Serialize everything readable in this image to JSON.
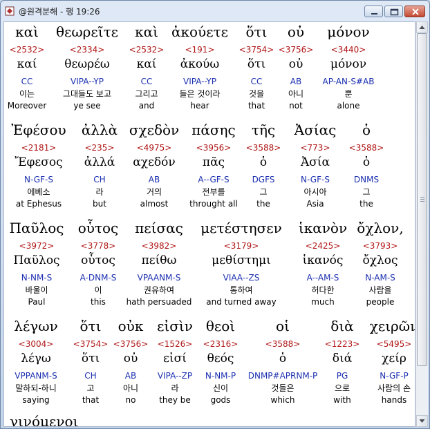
{
  "window": {
    "title": "@원격분해 - 행 19:26"
  },
  "colors": {
    "strong": "#b01515",
    "parse": "#1b2fb0",
    "titlebar": "#dfe9f6"
  },
  "rows": [
    {
      "words": [
        {
          "greek": "καὶ",
          "strong": "<2532>",
          "lemma": "καί",
          "parse": "CC",
          "korean": "이는",
          "english": "Moreover"
        },
        {
          "greek": "θεωρεῖτε",
          "strong": "<2334>",
          "lemma": "θεωρέω",
          "parse": "VIPA--YP",
          "korean": "그대들도 보고",
          "english": "ye see"
        },
        {
          "greek": "καὶ",
          "strong": "<2532>",
          "lemma": "καί",
          "parse": "CC",
          "korean": "그리고",
          "english": "and"
        },
        {
          "greek": "ἀκούετε",
          "strong": "<191>",
          "lemma": "ἀκούω",
          "parse": "VIPA--YP",
          "korean": "들은 것이라",
          "english": "hear"
        },
        {
          "greek": "ὅτι",
          "strong": "<3754>",
          "lemma": "ὅτι",
          "parse": "CC",
          "korean": "것을",
          "english": "that"
        },
        {
          "greek": "οὐ",
          "strong": "<3756>",
          "lemma": "οὐ",
          "parse": "AB",
          "korean": "아니",
          "english": "not"
        },
        {
          "greek": "μόνον",
          "strong": "<3440>",
          "lemma": "μόνον",
          "parse": "AP-AN-S#AB",
          "korean": "뿐",
          "english": "alone"
        }
      ]
    },
    {
      "words": [
        {
          "greek": "Ἐφέσου",
          "strong": "<2181>",
          "lemma": "Ἔφεσος",
          "parse": "N-GF-S",
          "korean": "에베소",
          "english": "at Ephesus"
        },
        {
          "greek": "ἀλλὰ",
          "strong": "<235>",
          "lemma": "ἀλλά",
          "parse": "CH",
          "korean": "라",
          "english": "but"
        },
        {
          "greek": "σχεδὸν",
          "strong": "<4975>",
          "lemma": "αχεδόν",
          "parse": "AB",
          "korean": "거의",
          "english": "almost"
        },
        {
          "greek": "πάσης",
          "strong": "<3956>",
          "lemma": "πᾶς",
          "parse": "A--GF-S",
          "korean": "전부를",
          "english": "throught all"
        },
        {
          "greek": "τῆς",
          "strong": "<3588>",
          "lemma": "ὁ",
          "parse": "DGFS",
          "korean": "그",
          "english": "the"
        },
        {
          "greek": "Ἀσίας",
          "strong": "<773>",
          "lemma": "Ἀσία",
          "parse": "N-GF-S",
          "korean": "아시아",
          "english": "Asia"
        },
        {
          "greek": "ὁ",
          "strong": "<3588>",
          "lemma": "ὁ",
          "parse": "DNMS",
          "korean": "그",
          "english": "the"
        }
      ]
    },
    {
      "words": [
        {
          "greek": "Παῦλος",
          "strong": "<3972>",
          "lemma": "Παῦλος",
          "parse": "N-NM-S",
          "korean": "바울이",
          "english": "Paul"
        },
        {
          "greek": "οὗτος",
          "strong": "<3778>",
          "lemma": "οὗτος",
          "parse": "A-DNM-S",
          "korean": "이",
          "english": "this"
        },
        {
          "greek": "πείσας",
          "strong": "<3982>",
          "lemma": "πείθω",
          "parse": "VPAANM-S",
          "korean": "권유하여",
          "english": "hath persuaded"
        },
        {
          "greek": "μετέστησεν",
          "strong": "<3179>",
          "lemma": "μεθίστημι",
          "parse": "VIAA--ZS",
          "korean": "통하여",
          "english": "and turned away"
        },
        {
          "greek": "ἱκανὸν",
          "strong": "<2425>",
          "lemma": "ἱκανός",
          "parse": "A--AM-S",
          "korean": "허다한",
          "english": "much"
        },
        {
          "greek": "ὄχλον,",
          "strong": "<3793>",
          "lemma": "ὄχλος",
          "parse": "N-AM-S",
          "korean": "사람을",
          "english": "people"
        }
      ]
    },
    {
      "words": [
        {
          "greek": "λέγων",
          "strong": "<3004>",
          "lemma": "λέγω",
          "parse": "VPPANM-S",
          "korean": "말하되-하니",
          "english": "saying"
        },
        {
          "greek": "ὅτι",
          "strong": "<3754>",
          "lemma": "ὅτι",
          "parse": "CH",
          "korean": "고",
          "english": "that"
        },
        {
          "greek": "οὐκ",
          "strong": "<3756>",
          "lemma": "οὐ",
          "parse": "AB",
          "korean": "아니",
          "english": "no"
        },
        {
          "greek": "εἰσὶν",
          "strong": "<1526>",
          "lemma": "εἰσί",
          "parse": "VIPA--ZP",
          "korean": "라",
          "english": "they be"
        },
        {
          "greek": "θεοὶ",
          "strong": "<2316>",
          "lemma": "θεός",
          "parse": "N-NM-P",
          "korean": "신이",
          "english": "gods"
        },
        {
          "greek": "οἱ",
          "strong": "<3588>",
          "lemma": "ὁ",
          "parse": "DNMP#APRNM-P",
          "korean": "것들은",
          "english": "which"
        },
        {
          "greek": "διὰ",
          "strong": "<1223>",
          "lemma": "διά",
          "parse": "PG",
          "korean": "으로",
          "english": "with"
        },
        {
          "greek": "χειρῶν",
          "strong": "<5495>",
          "lemma": "χείρ",
          "parse": "N-GF-P",
          "korean": "사람의 손",
          "english": "hands"
        }
      ]
    }
  ],
  "partial_next": "γινόμενοι"
}
